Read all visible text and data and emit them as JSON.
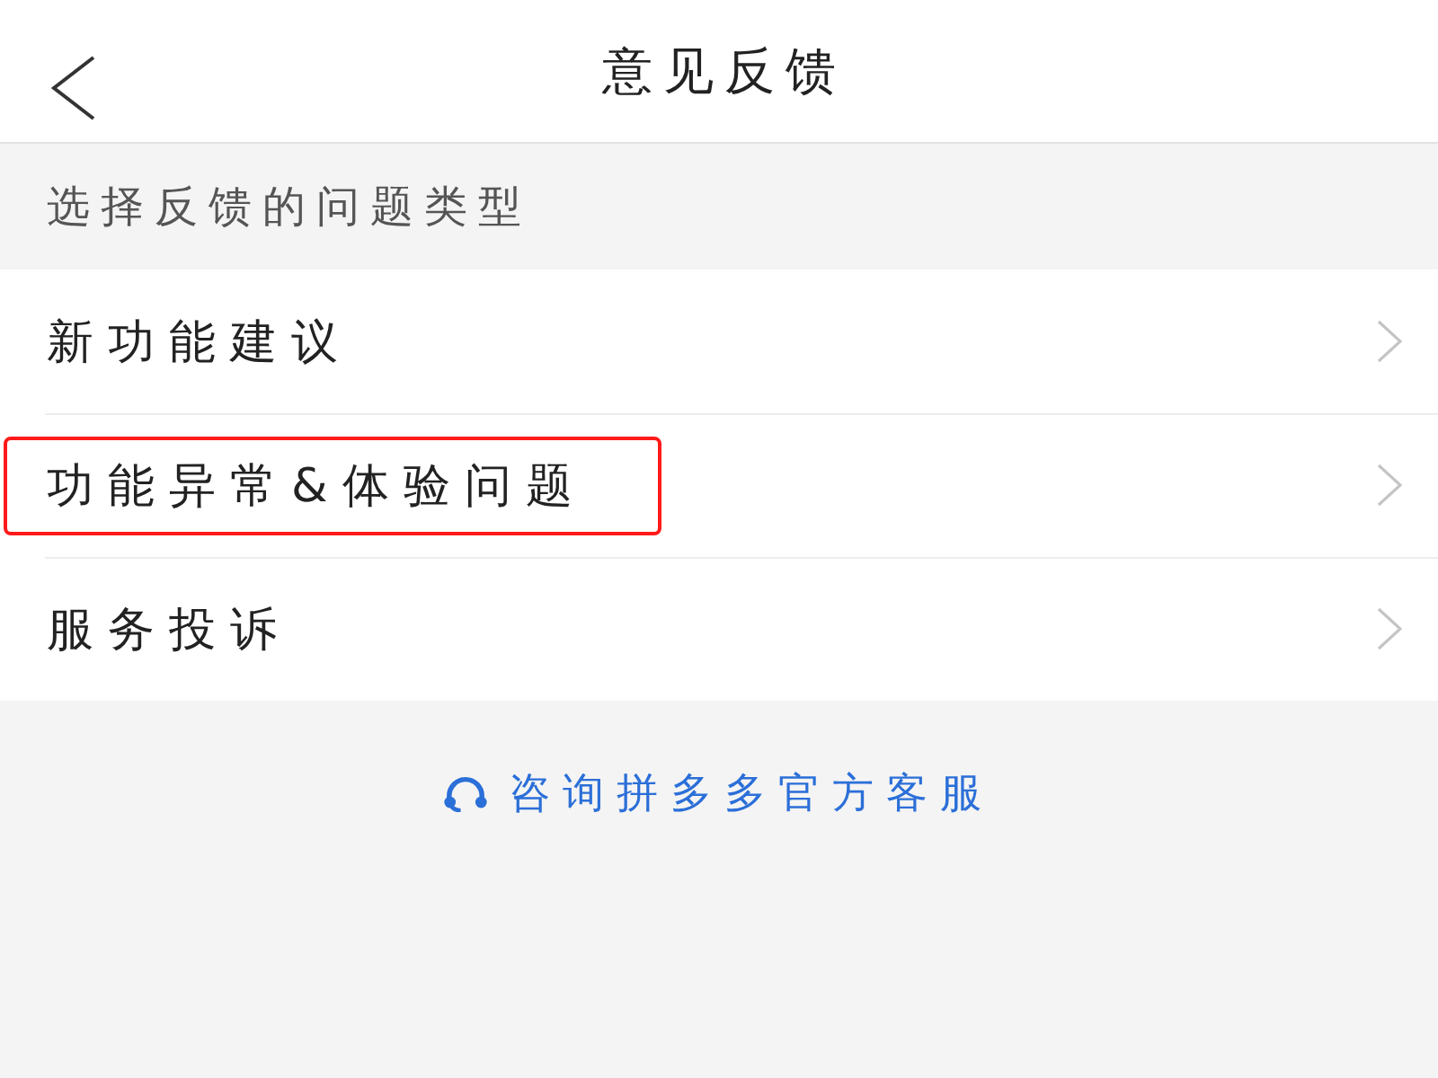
{
  "header": {
    "title": "意见反馈"
  },
  "section": {
    "title": "选择反馈的问题类型"
  },
  "items": [
    {
      "label": "新功能建议",
      "highlighted": false
    },
    {
      "label": "功能异常&体验问题",
      "highlighted": true
    },
    {
      "label": "服务投诉",
      "highlighted": false
    }
  ],
  "contact_link": {
    "label": "咨询拼多多官方客服"
  }
}
